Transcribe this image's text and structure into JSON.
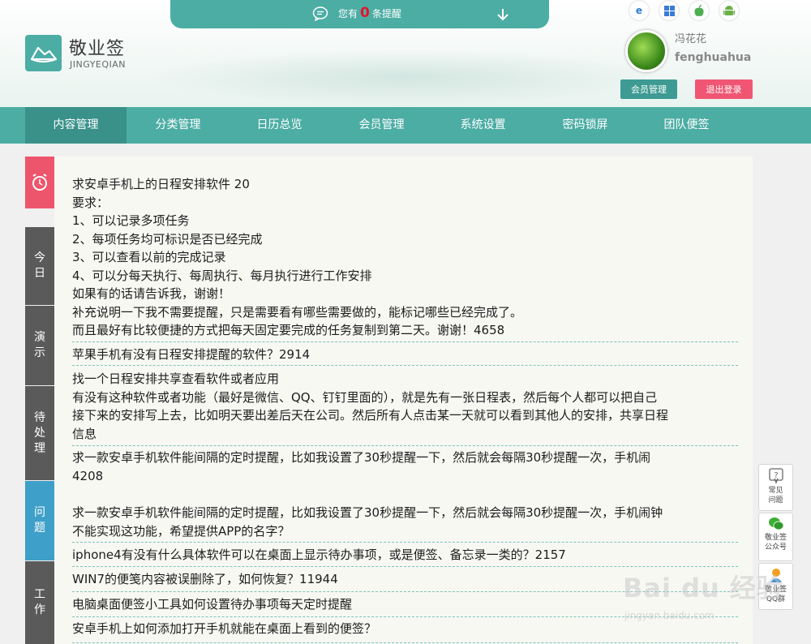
{
  "notice": {
    "prefix": "您有",
    "count": "0",
    "suffix": "条提醒"
  },
  "logo": {
    "title": "敬业签",
    "subtitle": "JINGYEQIAN"
  },
  "user": {
    "name_cn": "冯花花",
    "name_en": "fenghuahua",
    "member_button": "会员管理",
    "logout_button": "退出登录"
  },
  "platforms": [
    "ie-icon",
    "windows-icon",
    "apple-icon",
    "android-icon"
  ],
  "nav": [
    "内容管理",
    "分类管理",
    "日历总览",
    "会员管理",
    "系统设置",
    "密码锁屏",
    "团队便签"
  ],
  "left_tabs": [
    {
      "label": "今日",
      "chars": [
        "今",
        "日"
      ]
    },
    {
      "label": "演示",
      "chars": [
        "演",
        "示"
      ]
    },
    {
      "label": "待处理",
      "chars": [
        "待",
        "处",
        "理"
      ]
    },
    {
      "label": "问题",
      "chars": [
        "问",
        "题"
      ]
    },
    {
      "label": "工作",
      "chars": [
        "工",
        "作"
      ]
    }
  ],
  "entries": [
    {
      "lines": [
        "求安卓手机上的日程安排软件 20",
        "要求：",
        "1、可以记录多项任务",
        "2、每项任务均可标识是否已经完成",
        "3、可以查看以前的完成记录",
        "4、可以分每天执行、每周执行、每月执行进行工作安排",
        "如果有的话请告诉我，谢谢！",
        "补充说明一下我不需要提醒，只是需要看有哪些需要做的，能标记哪些已经完成了。",
        "而且最好有比较便捷的方式把每天固定要完成的任务复制到第二天。谢谢！4658"
      ]
    },
    {
      "lines": [
        "苹果手机有没有日程安排提醒的软件？2914"
      ]
    },
    {
      "lines": [
        "找一个日程安排共享查看软件或者应用",
        "有没有这种软件或者功能（最好是微信、QQ、钉钉里面的），就是先有一张日程表，然后每个人都可以把自己",
        "接下来的安排写上去，比如明天要出差后天在公司。然后所有人点击某一天就可以看到其他人的安排，共享日程",
        "信息"
      ]
    },
    {
      "lines": [
        "求一款安卓手机软件能间隔的定时提醒，比如我设置了30秒提醒一下，然后就会每隔30秒提醒一次，手机闹",
        "4208"
      ]
    },
    {
      "lines": [
        "求一款安卓手机软件能间隔的定时提醒，比如我设置了30秒提醒一下，然后就会每隔30秒提醒一次，手机闹钟",
        "不能实现这功能，希望提供APP的名字？"
      ]
    },
    {
      "lines": [
        "iphone4有没有什么具体软件可以在桌面上显示待办事项，或是便签、备忘录一类的？2157"
      ]
    },
    {
      "lines": [
        "WIN7的便笺内容被误删除了，如何恢复？11944"
      ]
    },
    {
      "lines": [
        "电脑桌面便签小工具如何设置待办事项每天定时提醒"
      ]
    },
    {
      "lines": [
        "安卓手机上如何添加打开手机就能在桌面上看到的便签？"
      ]
    }
  ],
  "float_bar": [
    {
      "label1": "常见",
      "label2": "问题"
    },
    {
      "label1": "敬业签",
      "label2": "公众号"
    },
    {
      "label1": "敬业签",
      "label2": "QQ群"
    }
  ],
  "watermark": {
    "text": "Bai du 经验",
    "sub": "jingyan.baidu.com"
  },
  "colors": {
    "brand": "#4cada4",
    "nav_active": "#3a918a",
    "alarm": "#ed556c",
    "tab_active": "#3e9fc8",
    "logout": "#f05673"
  }
}
